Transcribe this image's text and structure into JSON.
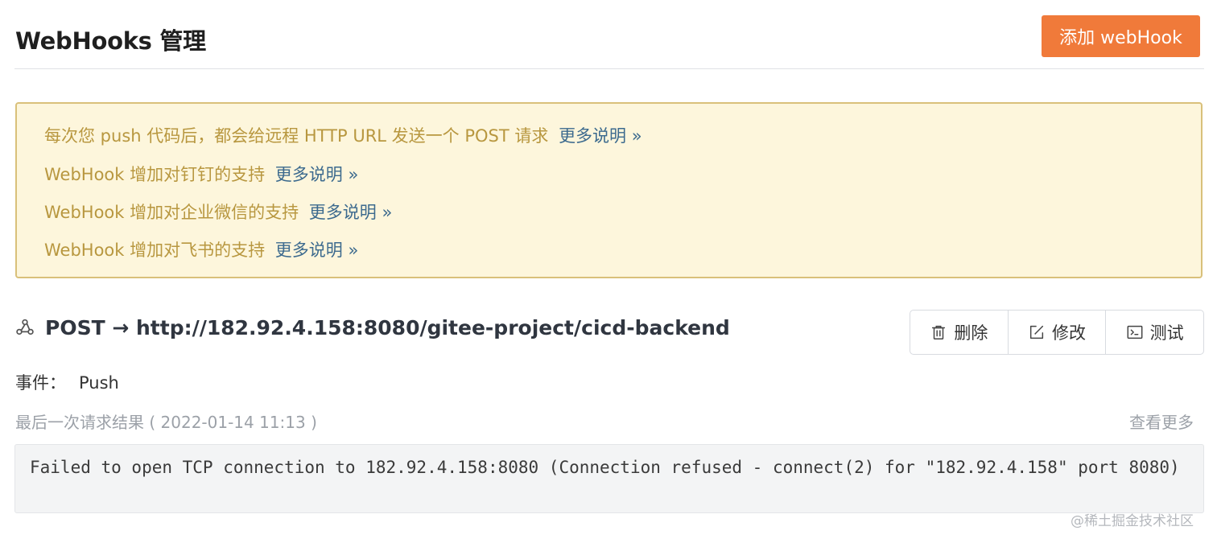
{
  "header": {
    "title": "WebHooks 管理",
    "add_button": "添加 webHook"
  },
  "notice": {
    "lines": [
      {
        "text": "每次您 push 代码后，都会给远程 HTTP URL 发送一个 POST 请求",
        "link": "更多说明 »"
      },
      {
        "text": "WebHook 增加对钉钉的支持",
        "link": "更多说明 »"
      },
      {
        "text": "WebHook 增加对企业微信的支持",
        "link": "更多说明 »"
      },
      {
        "text": "WebHook 增加对飞书的支持",
        "link": "更多说明 »"
      }
    ]
  },
  "hook": {
    "icon": "webhook-icon",
    "title": "POST → http://182.92.4.158:8080/gitee-project/cicd-backend",
    "actions": {
      "delete": "删除",
      "edit": "修改",
      "test": "测试"
    },
    "event_label": "事件：",
    "event_value": "Push",
    "last_result_label": "最后一次请求结果 ( 2022-01-14 11:13 )",
    "view_more": "查看更多",
    "result_text": "Failed to open TCP connection to 182.92.4.158:8080 (Connection refused - connect(2) for \"182.92.4.158\" port 8080)"
  },
  "watermark": "@稀土掘金技术社区",
  "colors": {
    "accent": "#f07a3a",
    "notice_bg": "#fdf6dc",
    "notice_text": "#b8973f",
    "link": "#3c6a8e"
  }
}
